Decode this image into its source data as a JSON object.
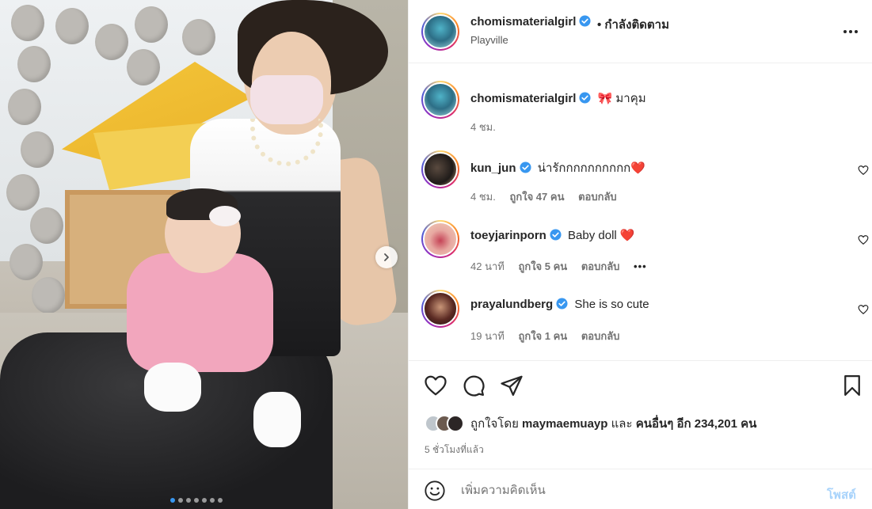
{
  "header": {
    "username": "chomismaterialgirl",
    "follow_text": "• กำลังติดตาม",
    "location": "Playville"
  },
  "caption": {
    "username": "chomismaterialgirl",
    "text": "🎀 มาคุม",
    "time": "4 ชม."
  },
  "comments": [
    {
      "username": "kun_jun",
      "text": "น่ารักกกกกกกกกก❤️",
      "time": "4 ชม.",
      "likes": "ถูกใจ 47 คน",
      "reply": "ตอบกลับ",
      "more": ""
    },
    {
      "username": "toeyjarinporn",
      "text": "Baby doll ❤️",
      "time": "42 นาที",
      "likes": "ถูกใจ 5 คน",
      "reply": "ตอบกลับ",
      "more": "•••"
    },
    {
      "username": "prayalundberg",
      "text": "She is so cute",
      "time": "19 นาที",
      "likes": "ถูกใจ 1 คน",
      "reply": "ตอบกลับ",
      "more": ""
    }
  ],
  "likes": {
    "prefix": "ถูกใจโดย",
    "first_user": "maymaemuayp",
    "joiner": "และ",
    "others": "คนอื่นๆ อีก 234,201 คน"
  },
  "time_ago": "5 ชั่วโมงที่แล้ว",
  "compose": {
    "placeholder": "เพิ่มความคิดเห็น",
    "post_label": "โพสต์"
  },
  "carousel": {
    "current": 1,
    "total": 7
  },
  "colors": {
    "verified": "#3897f0",
    "post_disabled": "#a8d3fb",
    "heart": "#ed4956"
  },
  "icons": [
    "more-icon",
    "verified-icon",
    "heart-icon",
    "comment-icon",
    "share-icon",
    "bookmark-icon",
    "emoji-icon",
    "chevron-right-icon"
  ]
}
